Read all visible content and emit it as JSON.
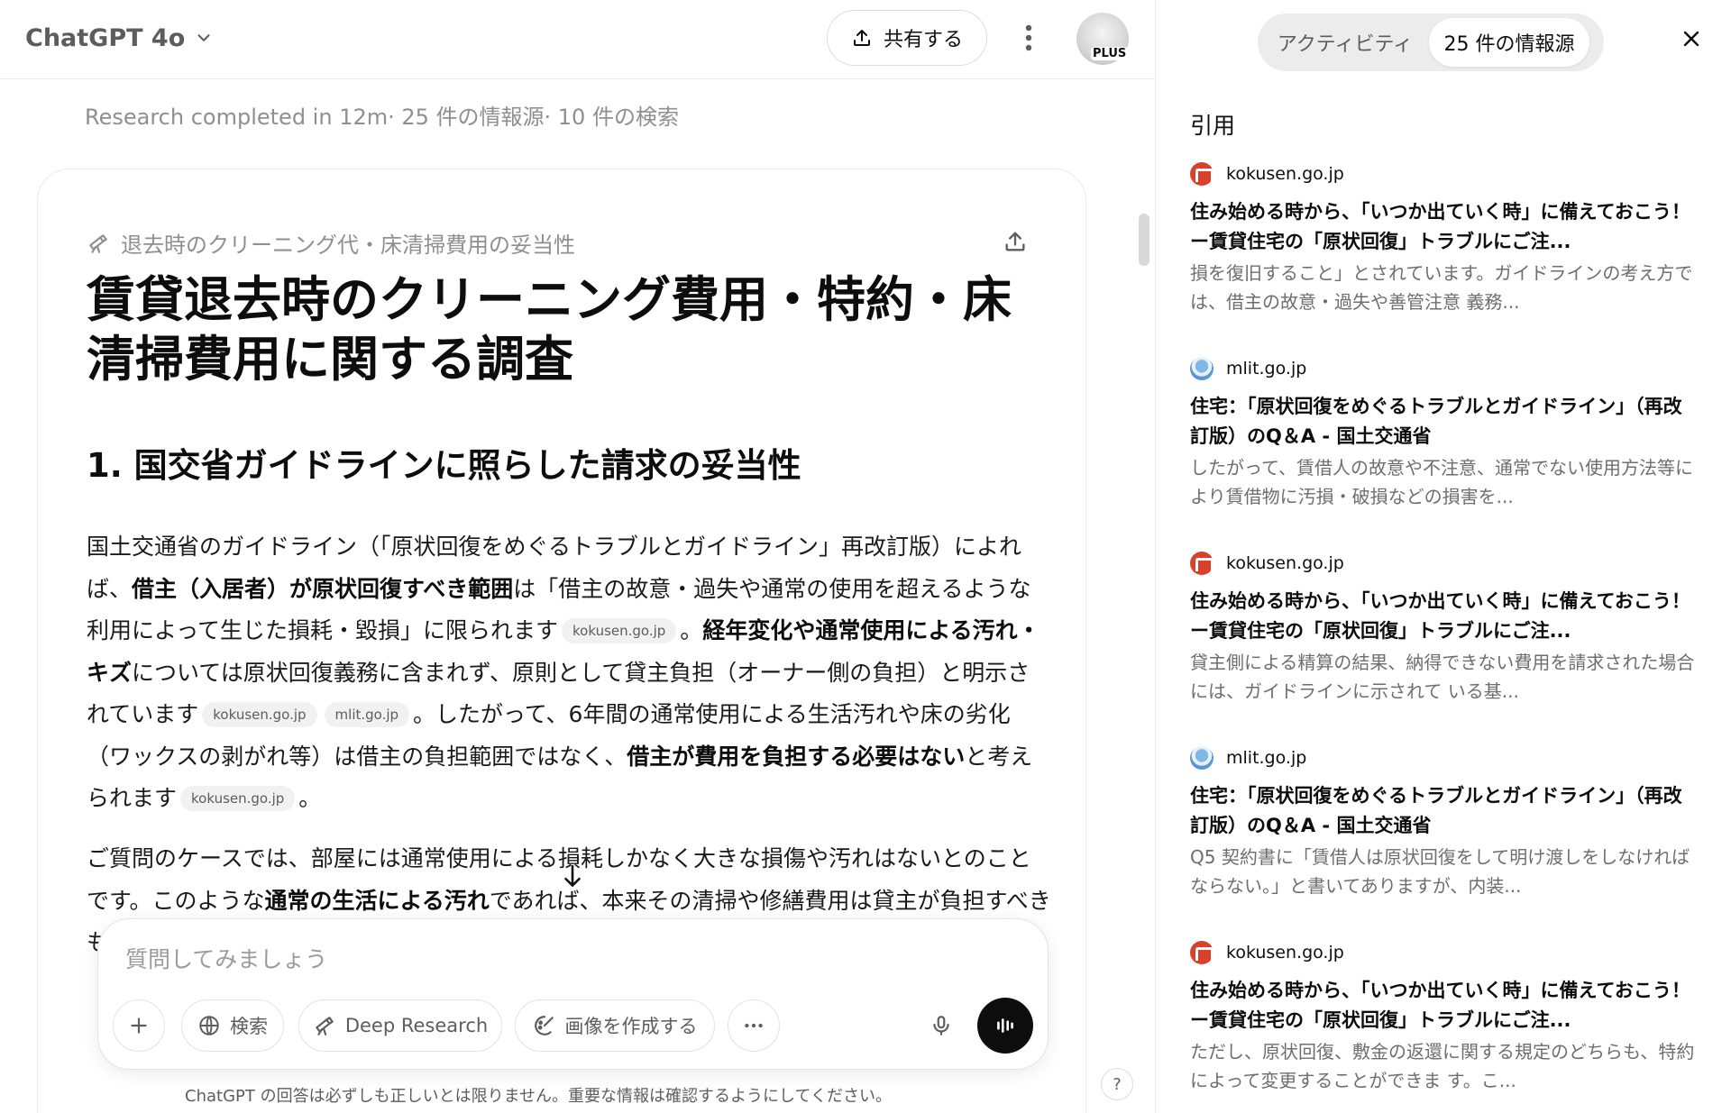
{
  "header": {
    "model": "ChatGPT 4o",
    "share_label": "共有する",
    "plus_badge": "PLUS"
  },
  "status": "Research completed in 12m· 25 件の情報源· 10 件の検索",
  "card": {
    "topic": "退去時のクリーニング代・床清掃費用の妥当性",
    "title": "賃貸退去時のクリーニング費用・特約・床清掃費用に関する調査",
    "section_1": "1. 国交省ガイドラインに照らした請求の妥当性",
    "p1": {
      "t1": "国土交通省のガイドライン（「原状回復をめぐるトラブルとガイドライン」再改訂版）によれば、",
      "b1": "借主（入居者）が原状回復すべき範囲",
      "t2": "は「借主の故意・過失や通常の使用を超えるような利用によって生じた損耗・毀損」に限られます",
      "c1": "kokusen.go.jp",
      "t3": "。",
      "b2": "経年変化や通常使用による汚れ・キズ",
      "t4": "については原状回復義務に含まれず、原則として貸主負担（オーナー側の負担）と明示されています",
      "c2": "kokusen.go.jp",
      "c3": "mlit.go.jp",
      "t5": "。したがって、6年間の通常使用による生活汚れや床の劣化（ワックスの剥がれ等）は借主の負担範囲ではなく、",
      "b3": "借主が費用を負担する必要はない",
      "t6": "と考えられます",
      "c4": "kokusen.go.jp",
      "t7": "。"
    },
    "p2": {
      "t1": "ご質問のケースでは、部屋には通常使用による損耗しかなく大きな損傷や汚れはないとのことです。このような",
      "b1": "通常の生活による汚れ",
      "t2": "であれば、本来その清掃や修繕費用は貸主が負担すべきものです。"
    }
  },
  "composer": {
    "placeholder": "質問してみましょう",
    "search_label": "検索",
    "deep_research_label": "Deep Research",
    "image_label": "画像を作成する"
  },
  "footnote": "ChatGPT の回答は必ずしも正しいとは限りません。重要な情報は確認するようにしてください。",
  "help": "?",
  "panel": {
    "tab_activity": "アクティビティ",
    "tab_sources": "25 件の情報源",
    "citations_label": "引用",
    "sources": [
      {
        "domain": "kokusen.go.jp",
        "favicon": "kokusen",
        "title": "住み始める時から、「いつか出ていく時」に備えておこう！ー賃貸住宅の「原状回復」トラブルにご注...",
        "snippet": "損を復旧すること」とされています。ガイドラインの考え方では、借主の故意・過失や善管注意 義務..."
      },
      {
        "domain": "mlit.go.jp",
        "favicon": "mlit",
        "title": "住宅：「原状回復をめぐるトラブルとガイドライン」（再改訂版）のQ＆A - 国土交通省",
        "snippet": "したがって、賃借人の故意や不注意、通常でない使用方法等により賃借物に汚損・破損などの損害を..."
      },
      {
        "domain": "kokusen.go.jp",
        "favicon": "kokusen",
        "title": "住み始める時から、「いつか出ていく時」に備えておこう！ー賃貸住宅の「原状回復」トラブルにご注...",
        "snippet": "貸主側による精算の結果、納得できない費用を請求された場合には、ガイドラインに示されて いる基..."
      },
      {
        "domain": "mlit.go.jp",
        "favicon": "mlit",
        "title": "住宅：「原状回復をめぐるトラブルとガイドライン」（再改訂版）のQ＆A - 国土交通省",
        "snippet": "Q5 契約書に「賃借人は原状回復をして明け渡しをしなければならない。」と書いてありますが、内装..."
      },
      {
        "domain": "kokusen.go.jp",
        "favicon": "kokusen",
        "title": "住み始める時から、「いつか出ていく時」に備えておこう！ー賃貸住宅の「原状回復」トラブルにご注...",
        "snippet": "ただし、原状回復、敷金の返還に関する規定のどちらも、特約によって変更することができま す。こ..."
      }
    ]
  }
}
